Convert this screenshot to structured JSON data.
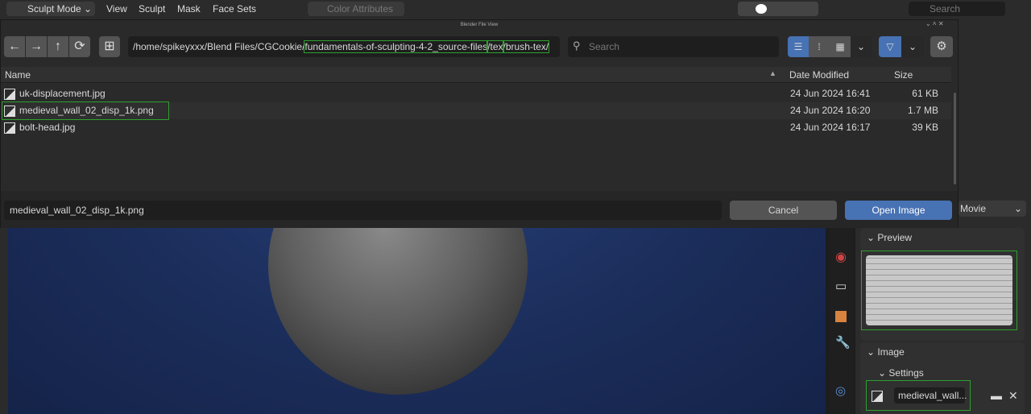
{
  "topbar": {
    "mode": "Sculpt Mode",
    "menus": [
      "View",
      "Sculpt",
      "Mask",
      "Face Sets"
    ],
    "color_attributes": "Color Attributes",
    "search_placeholder": "Search"
  },
  "dialog": {
    "title": "Blender File View",
    "path": {
      "prefix": "/home/spikeyxxx/Blend Files/CGCookie/",
      "seg1": "fundamentals-of-sculpting-4-2_source-files",
      "seg2": "/tex",
      "seg3": "/brush-tex/"
    },
    "search_placeholder": "Search",
    "columns": {
      "name": "Name",
      "date": "Date Modified",
      "size": "Size"
    },
    "files": [
      {
        "name": "uk-displacement.jpg",
        "date": "24 Jun 2024 16:41",
        "size": "61 KB"
      },
      {
        "name": "medieval_wall_02_disp_1k.png",
        "date": "24 Jun 2024 16:20",
        "size": "1.7 MB"
      },
      {
        "name": "bolt-head.jpg",
        "date": "24 Jun 2024 16:17",
        "size": "39 KB"
      }
    ],
    "filename": "medieval_wall_02_disp_1k.png",
    "cancel": "Cancel",
    "open": "Open Image",
    "accent": "#4772b3"
  },
  "props": {
    "movie": "Movie",
    "preview": "Preview",
    "image": "Image",
    "settings": "Settings",
    "image_name": "medieval_wall..."
  }
}
